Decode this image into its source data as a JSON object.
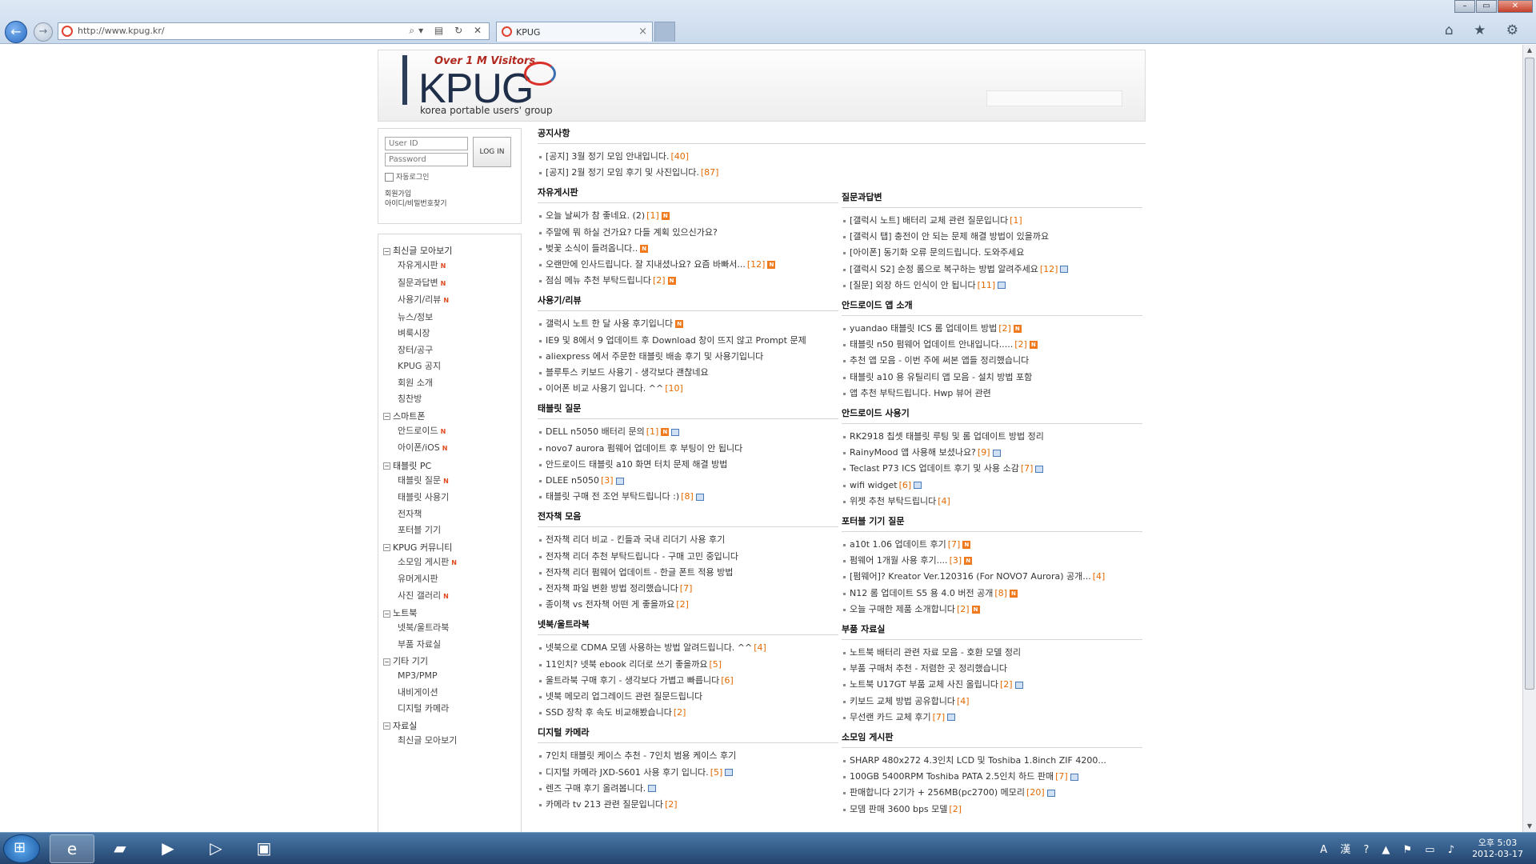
{
  "browser": {
    "url": "http://www.kpug.kr/",
    "tab_title": "KPUG",
    "tools": "⌕▾ ▤ ↻ ✕",
    "back_glyph": "←",
    "fwd_glyph": "→",
    "right_icons": "⌂ ★ ⚙",
    "win_min": "–",
    "win_max": "▭",
    "win_close": "✕"
  },
  "header": {
    "tagline": "Over 1 M Visitors",
    "logo": "KPUG",
    "subtitle": "korea portable users' group"
  },
  "login": {
    "userid_placeholder": "User ID",
    "password_placeholder": "Password",
    "button": "LOG IN",
    "remember": "자동로그인",
    "links": "회원가입\n아이디/비밀번호찾기"
  },
  "menu": [
    {
      "title": "최신글 모아보기",
      "items": [
        {
          "label": "자유게시판",
          "new": true
        },
        {
          "label": "질문과답변",
          "new": true
        },
        {
          "label": "사용기/리뷰",
          "new": true
        },
        {
          "label": "뉴스/정보",
          "new": false
        },
        {
          "label": "벼룩시장",
          "new": false
        },
        {
          "label": "장터/공구",
          "new": false
        },
        {
          "label": "KPUG 공지",
          "new": false
        },
        {
          "label": "회원 소개",
          "new": false
        },
        {
          "label": "칭찬방",
          "new": false
        }
      ]
    },
    {
      "title": "스마트폰",
      "items": [
        {
          "label": "안드로이드",
          "new": true
        },
        {
          "label": "아이폰/iOS",
          "new": true
        }
      ]
    },
    {
      "title": "태블릿 PC",
      "items": [
        {
          "label": "태블릿 질문",
          "new": true
        },
        {
          "label": "태블릿 사용기",
          "new": false
        },
        {
          "label": "전자책",
          "new": false
        },
        {
          "label": "포터블 기기",
          "new": false
        }
      ]
    },
    {
      "title": "KPUG 커뮤니티",
      "items": [
        {
          "label": "소모임 게시판",
          "new": true
        },
        {
          "label": "유머게시판",
          "new": false
        },
        {
          "label": "사진 갤러리",
          "new": true
        }
      ]
    },
    {
      "title": "노트북",
      "items": [
        {
          "label": "넷북/울트라북",
          "new": false
        },
        {
          "label": "부품 자료실",
          "new": false
        }
      ]
    },
    {
      "title": "기타 기기",
      "items": [
        {
          "label": "MP3/PMP",
          "new": false
        },
        {
          "label": "내비게이션",
          "new": false
        },
        {
          "label": "디지털 카메라",
          "new": false
        }
      ]
    },
    {
      "title": "자료실",
      "items": [
        {
          "label": "최신글 모아보기",
          "new": false
        }
      ]
    }
  ],
  "sections": [
    {
      "title": "공지사항",
      "items": [
        {
          "text": "[공지] 3월 정기 모임 안내입니다.",
          "count": "[40]",
          "n": false,
          "img": false
        },
        {
          "text": "[공지] 2월 정기 모임 후기 및 사진입니다.",
          "count": "[87]",
          "n": false,
          "img": false
        }
      ]
    },
    {
      "title": "자유게시판",
      "items": [
        {
          "text": "오늘 날씨가 참 좋네요. (2)",
          "count": "[1]",
          "n": true,
          "img": false
        },
        {
          "text": "주말에 뭐 하실 건가요? 다들 계획 있으신가요?",
          "count": "",
          "n": false,
          "img": false
        },
        {
          "text": "벚꽃 소식이 들려옵니다..",
          "count": "",
          "n": true,
          "img": false
        },
        {
          "text": "오랜만에 인사드립니다. 잘 지내셨나요? 요즘 바빠서...",
          "count": "[12]",
          "n": true,
          "img": false
        },
        {
          "text": "점심 메뉴 추천 부탁드립니다",
          "count": "[2]",
          "n": true,
          "img": false
        }
      ]
    },
    {
      "title": "질문과답변",
      "items": [
        {
          "text": "[갤럭시 노트] 배터리 교체 관련 질문입니다",
          "count": "[1]",
          "n": false,
          "img": false
        },
        {
          "text": "[갤럭시 탭] 충전이 안 되는 문제 해결 방법이 있을까요",
          "count": "",
          "n": false,
          "img": false
        },
        {
          "text": "[아이폰] 동기화 오류 문의드립니다. 도와주세요",
          "count": "",
          "n": false,
          "img": false
        },
        {
          "text": "[갤럭시 S2] 순정 롬으로 복구하는 방법 알려주세요",
          "count": "[12]",
          "n": false,
          "img": true
        },
        {
          "text": "[질문] 외장 하드 인식이 안 됩니다",
          "count": "[11]",
          "n": false,
          "img": true
        }
      ]
    },
    {
      "title": "사용기/리뷰",
      "items": [
        {
          "text": "갤럭시 노트 한 달 사용 후기입니다",
          "count": "",
          "n": true,
          "img": false
        },
        {
          "text": "IE9 및 8에서 9 업데이트 후 Download 창이 뜨지 않고 Prompt 문제",
          "count": "",
          "n": false,
          "img": false
        },
        {
          "text": "aliexpress 에서 주문한 태블릿 배송 후기 및 사용기입니다",
          "count": "",
          "n": false,
          "img": false
        },
        {
          "text": "블루투스 키보드 사용기 - 생각보다 괜찮네요",
          "count": "",
          "n": false,
          "img": false
        },
        {
          "text": "이어폰 비교 사용기 입니다. ^^",
          "count": "[10]",
          "n": false,
          "img": false
        }
      ]
    },
    {
      "title": "안드로이드 앱 소개",
      "items": [
        {
          "text": "yuandao 태블릿 ICS 롬 업데이트 방법",
          "count": "[2]",
          "n": true,
          "img": false
        },
        {
          "text": "태블릿 n50 펌웨어 업데이트 안내입니다.....",
          "count": "[2]",
          "n": true,
          "img": false
        },
        {
          "text": "추천 앱 모음 - 이번 주에 써본 앱들 정리했습니다",
          "count": "",
          "n": false,
          "img": false
        },
        {
          "text": "태블릿 a10 용 유틸리티 앱 모음 - 설치 방법 포함",
          "count": "",
          "n": false,
          "img": false
        },
        {
          "text": "앱 추천 부탁드립니다. Hwp 뷰어 관련",
          "count": "",
          "n": false,
          "img": false
        }
      ]
    },
    {
      "title": "태블릿 질문",
      "items": [
        {
          "text": "DELL n5050 배터리 문의",
          "count": "[1]",
          "n": true,
          "img": true
        },
        {
          "text": "novo7 aurora 펌웨어 업데이트 후 부팅이 안 됩니다",
          "count": "",
          "n": false,
          "img": false
        },
        {
          "text": "안드로이드 태블릿 a10 화면 터치 문제 해결 방법",
          "count": "",
          "n": false,
          "img": false
        },
        {
          "text": "DLEE n5050",
          "count": "[3]",
          "n": false,
          "img": true
        },
        {
          "text": "태블릿 구매 전 조언 부탁드립니다 :)",
          "count": "[8]",
          "n": false,
          "img": true
        }
      ]
    },
    {
      "title": "안드로이드 사용기",
      "items": [
        {
          "text": "RK2918 칩셋 태블릿 루팅 및 롬 업데이트 방법 정리",
          "count": "",
          "n": false,
          "img": false
        },
        {
          "text": "RainyMood 앱 사용해 보셨나요?",
          "count": "[9]",
          "n": false,
          "img": true
        },
        {
          "text": "Teclast P73 ICS 업데이트 후기 및 사용 소감",
          "count": "[7]",
          "n": false,
          "img": true
        },
        {
          "text": "wifi widget",
          "count": "[6]",
          "n": false,
          "img": true
        },
        {
          "text": "위젯 추천 부탁드립니다",
          "count": "[4]",
          "n": false,
          "img": false
        }
      ]
    },
    {
      "title": "전자책 모음",
      "items": [
        {
          "text": "전자책 리더 비교 - 킨들과 국내 리더기 사용 후기",
          "count": "",
          "n": false,
          "img": false
        },
        {
          "text": "전자책 리더 추천 부탁드립니다 - 구매 고민 중입니다",
          "count": "",
          "n": false,
          "img": false
        },
        {
          "text": "전자책 리더 펌웨어 업데이트 - 한글 폰트 적용 방법",
          "count": "",
          "n": false,
          "img": false
        },
        {
          "text": "전자책 파일 변환 방법 정리했습니다",
          "count": "[7]",
          "n": false,
          "img": false
        },
        {
          "text": "종이책 vs 전자책 어떤 게 좋을까요",
          "count": "[2]",
          "n": false,
          "img": false
        }
      ]
    },
    {
      "title": "포터블 기기 질문",
      "items": [
        {
          "text": "a10t 1.06 업데이트 후기",
          "count": "[7]",
          "n": true,
          "img": false
        },
        {
          "text": "펌웨어 1개월 사용 후기....",
          "count": "[3]",
          "n": true,
          "img": false
        },
        {
          "text": "[펌웨어]? Kreator Ver.120316 (For NOVO7 Aurora) 공개...",
          "count": "[4]",
          "n": false,
          "img": false
        },
        {
          "text": "N12 롬 업데이트 S5 용 4.0 버전 공개",
          "count": "[8]",
          "n": true,
          "img": false
        },
        {
          "text": "오늘 구매한 제품 소개합니다",
          "count": "[2]",
          "n": true,
          "img": false
        }
      ]
    },
    {
      "title": "넷북/울트라북",
      "items": [
        {
          "text": "넷북으로 CDMA 모뎀 사용하는 방법 알려드립니다. ^^",
          "count": "[4]",
          "n": false,
          "img": false
        },
        {
          "text": "11인치? 넷북 ebook 리더로 쓰기 좋을까요",
          "count": "[5]",
          "n": false,
          "img": false
        },
        {
          "text": "울트라북 구매 후기 - 생각보다 가볍고 빠릅니다",
          "count": "[6]",
          "n": false,
          "img": false
        },
        {
          "text": "넷북 메모리 업그레이드 관련 질문드립니다",
          "count": "",
          "n": false,
          "img": false
        },
        {
          "text": "SSD 장착 후 속도 비교해봤습니다",
          "count": "[2]",
          "n": false,
          "img": false
        }
      ]
    },
    {
      "title": "부품 자료실",
      "items": [
        {
          "text": "노트북 배터리 관련 자료 모음 - 호환 모델 정리",
          "count": "",
          "n": false,
          "img": false
        },
        {
          "text": "부품 구매처 추천 - 저렴한 곳 정리했습니다",
          "count": "",
          "n": false,
          "img": false
        },
        {
          "text": "노트북 U17GT 부품 교체 사진 올립니다",
          "count": "[2]",
          "n": false,
          "img": true
        },
        {
          "text": "키보드 교체 방법 공유합니다",
          "count": "[4]",
          "n": false,
          "img": false
        },
        {
          "text": "무선랜 카드 교체 후기",
          "count": "[7]",
          "n": false,
          "img": true
        }
      ]
    },
    {
      "title": "디지털 카메라",
      "items": [
        {
          "text": "7인치 태블릿 케이스 추천 - 7인치 범용 케이스 후기",
          "count": "",
          "n": false,
          "img": false
        },
        {
          "text": "디지털 카메라 JXD-S601 사용 후기 입니다.",
          "count": "[5]",
          "n": false,
          "img": true
        },
        {
          "text": "렌즈 구매 후기 올려봅니다.",
          "count": "",
          "n": false,
          "img": true
        },
        {
          "text": "카메라 tv 213 관련 질문입니다",
          "count": "[2]",
          "n": false,
          "img": false
        }
      ]
    },
    {
      "title": "소모임 게시판",
      "items": [
        {
          "text": "SHARP 480x272 4.3인치 LCD 및 Toshiba 1.8inch ZIF 4200...",
          "count": "",
          "n": false,
          "img": false
        },
        {
          "text": "100GB 5400RPM Toshiba PATA 2.5인치 하드 판매",
          "count": "[7]",
          "n": false,
          "img": true
        },
        {
          "text": "판매합니다 2기가 + 256MB(pc2700) 메모리",
          "count": "[20]",
          "n": false,
          "img": true
        },
        {
          "text": "모뎀 판매 3600 bps 모델",
          "count": "[2]",
          "n": false,
          "img": false
        }
      ]
    }
  ],
  "taskbar": {
    "time": "오후 5:03",
    "date": "2012-03-17",
    "tray": "A 漢 ? ▲ ⚑ ▭ ♪"
  }
}
